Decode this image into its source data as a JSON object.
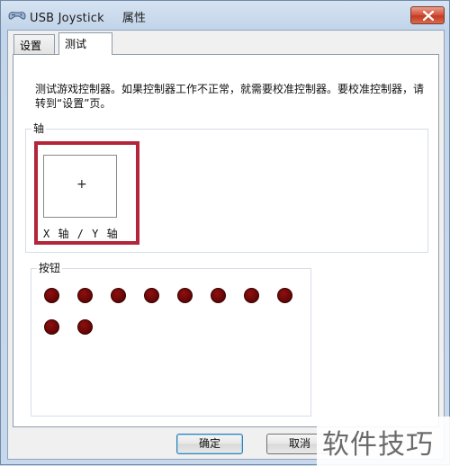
{
  "window": {
    "title": "USB Joystick",
    "subtitle": "属性"
  },
  "tabs": [
    {
      "label": "设置",
      "active": false
    },
    {
      "label": "测试",
      "active": true
    }
  ],
  "panel": {
    "description": "测试游戏控制器。如果控制器工作不正常，就需要校准控制器。要校准控制器，请转到“设置”页。",
    "axes_group_label": "轴",
    "axis_crosshair": "+",
    "axis_label": "X 轴 / Y 轴",
    "buttons_group_label": "按钮",
    "button_count": 10
  },
  "footer": {
    "ok_label": "确定",
    "cancel_label": "取消"
  },
  "watermark": "软件技巧",
  "colors": {
    "highlight": "#b3263a",
    "button_indicator": "#6d0707",
    "close_button": "#c43b22"
  }
}
